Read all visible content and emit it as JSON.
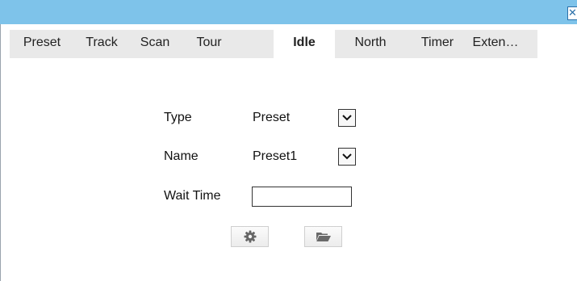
{
  "window": {
    "close_glyph": "✕",
    "titlebar_color": "#7ec3ea"
  },
  "tabs": [
    {
      "label": "Preset",
      "active": false
    },
    {
      "label": "Track",
      "active": false
    },
    {
      "label": "Scan",
      "active": false
    },
    {
      "label": "Tour",
      "active": false
    },
    {
      "label": "Idle",
      "active": true
    },
    {
      "label": "North",
      "active": false
    },
    {
      "label": "Timer",
      "active": false
    },
    {
      "label": "Exten…",
      "active": false
    }
  ],
  "form": {
    "type_label": "Type",
    "type_value": "Preset",
    "name_label": "Name",
    "name_value": "Preset1",
    "wait_time_label": "Wait Time",
    "wait_time_value": ""
  },
  "buttons": {
    "settings_icon": "gear-icon",
    "open_icon": "folder-open-icon"
  }
}
